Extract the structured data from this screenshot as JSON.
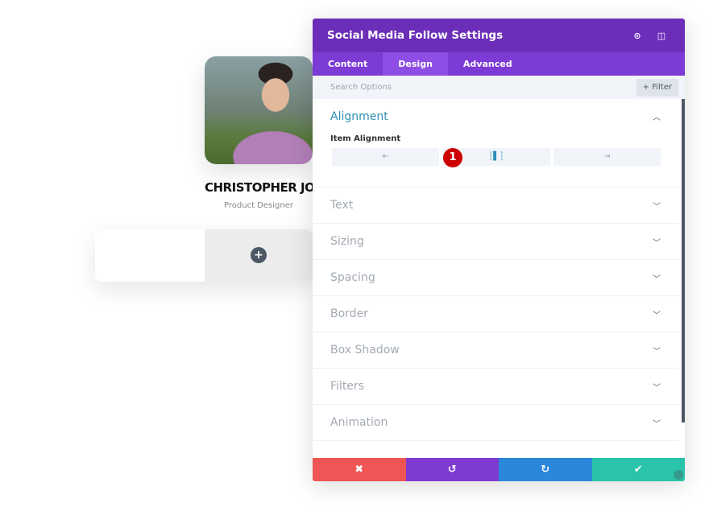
{
  "profile": {
    "name": "CHRISTOPHER JOE",
    "role": "Product Designer",
    "add_icon": "plus-icon"
  },
  "panel": {
    "title": "Social Media Follow Settings",
    "header_icons": [
      "fullscreen-icon",
      "sidebar-icon"
    ],
    "tabs": [
      {
        "label": "Content"
      },
      {
        "label": "Design",
        "active": true
      },
      {
        "label": "Advanced"
      }
    ],
    "search_placeholder": "Search Options",
    "filter_label": "+ Filter",
    "alignment": {
      "title": "Alignment",
      "item_alignment_label": "Item Alignment",
      "options": [
        "left",
        "center",
        "right"
      ],
      "selected": "center",
      "badge": "1"
    },
    "sections": [
      {
        "label": "Text"
      },
      {
        "label": "Sizing"
      },
      {
        "label": "Spacing"
      },
      {
        "label": "Border"
      },
      {
        "label": "Box Shadow"
      },
      {
        "label": "Filters"
      },
      {
        "label": "Animation"
      }
    ],
    "footer": {
      "colors": {
        "cancel": "#ef5555",
        "undo": "#7e3bd0",
        "redo": "#2b87da",
        "save": "#29c4a9"
      }
    }
  },
  "colors": {
    "header": "#6c2eb9",
    "tabs": "#7d3bd6",
    "accent": "#2d8fb5"
  }
}
